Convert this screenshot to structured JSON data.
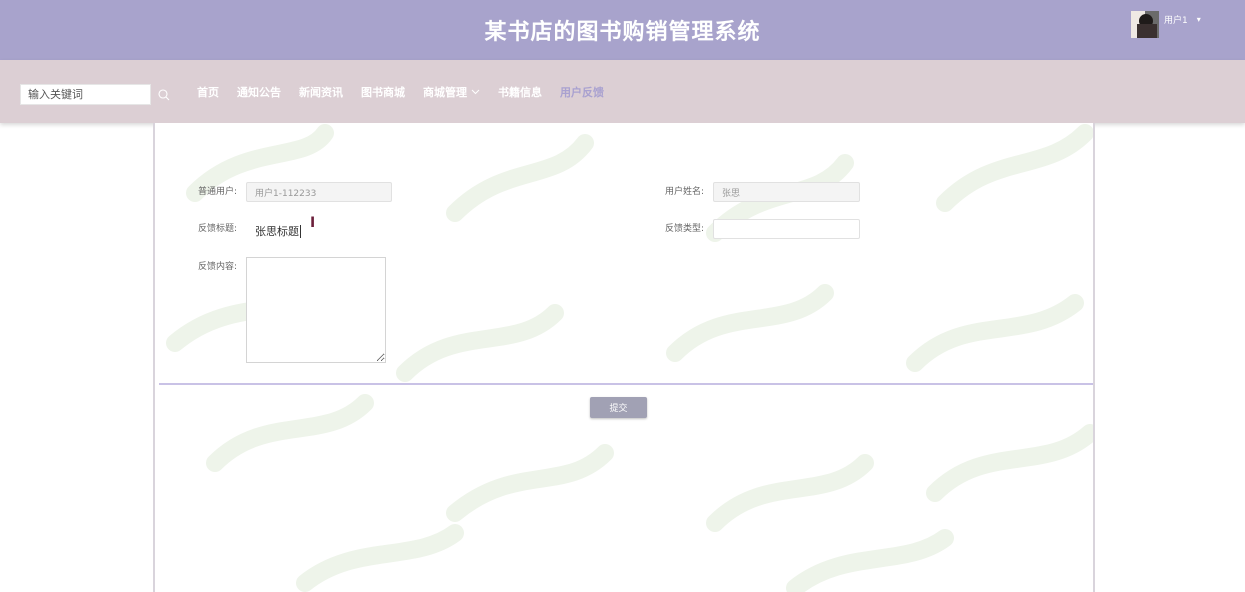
{
  "header": {
    "title": "某书店的图书购销管理系统",
    "user_name": "用户1",
    "caret": "▾"
  },
  "nav": {
    "search_placeholder": "输入关键词",
    "items": [
      {
        "label": "首页"
      },
      {
        "label": "通知公告"
      },
      {
        "label": "新闻资讯"
      },
      {
        "label": "图书商城"
      },
      {
        "label": "商城管理"
      },
      {
        "label": "书籍信息"
      },
      {
        "label": "用户反馈"
      }
    ],
    "active": "用户反馈"
  },
  "form": {
    "user_label": "普通用户:",
    "user_value": "用户1-112233",
    "name_label": "用户姓名:",
    "name_value": "张思",
    "title_label": "反馈标题:",
    "title_value": "张思标题",
    "type_label": "反馈类型:",
    "type_value": "",
    "content_label": "反馈内容:",
    "submit_label": "提交"
  },
  "icons": {
    "search": "search-icon",
    "avatar": "user-avatar",
    "text_cursor": "text-cursor-icon",
    "chevron": "chevron-down-icon"
  },
  "colors": {
    "header": "#a8a3cc",
    "navbar": "#dccfd4",
    "active_nav": "#a9a1d0",
    "divider": "#c9c2e6",
    "button": "#a1a1b4"
  }
}
